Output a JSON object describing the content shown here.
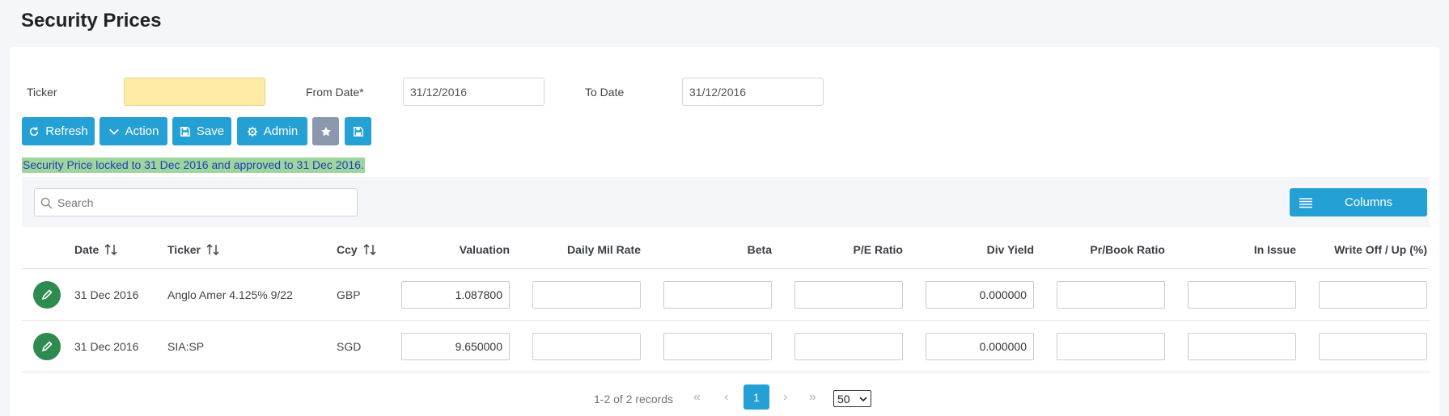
{
  "page": {
    "title": "Security Prices"
  },
  "filters": {
    "ticker_label": "Ticker",
    "ticker_value": "",
    "from_label": "From Date*",
    "from_value": "31/12/2016",
    "to_label": "To Date",
    "to_value": "31/12/2016"
  },
  "toolbar": {
    "refresh": "Refresh",
    "action": "Action",
    "save": "Save",
    "admin": "Admin"
  },
  "notice": "Security Price locked to 31 Dec 2016 and approved to 31 Dec 2016.",
  "grid": {
    "search_placeholder": "Search",
    "columns_button": "Columns",
    "headers": {
      "date": "Date",
      "ticker": "Ticker",
      "ccy": "Ccy",
      "valuation": "Valuation",
      "daily_mil_rate": "Daily Mil Rate",
      "beta": "Beta",
      "pe_ratio": "P/E Ratio",
      "div_yield": "Div Yield",
      "pr_book_ratio": "Pr/Book Ratio",
      "in_issue": "In Issue",
      "write_off": "Write Off / Up (%)"
    },
    "rows": [
      {
        "date": "31 Dec 2016",
        "ticker": "Anglo Amer 4.125% 9/22",
        "ccy": "GBP",
        "valuation": "1.087800",
        "daily_mil_rate": "",
        "beta": "",
        "pe_ratio": "",
        "div_yield": "0.000000",
        "pr_book_ratio": "",
        "in_issue": "",
        "write_off": ""
      },
      {
        "date": "31 Dec 2016",
        "ticker": "SIA:SP",
        "ccy": "SGD",
        "valuation": "9.650000",
        "daily_mil_rate": "",
        "beta": "",
        "pe_ratio": "",
        "div_yield": "0.000000",
        "pr_book_ratio": "",
        "in_issue": "",
        "write_off": ""
      }
    ]
  },
  "pager": {
    "summary": "1-2 of 2 records",
    "first": "«",
    "prev": "‹",
    "current": "1",
    "next": "›",
    "last": "»",
    "page_size": "50"
  },
  "colors": {
    "primary": "#24a0d4",
    "edit": "#2e8b4f",
    "ticker_bg": "#ffeba3",
    "notice_bg": "#9fd49c",
    "notice_text": "#1d3fb8",
    "secondary": "#8a97ad"
  }
}
